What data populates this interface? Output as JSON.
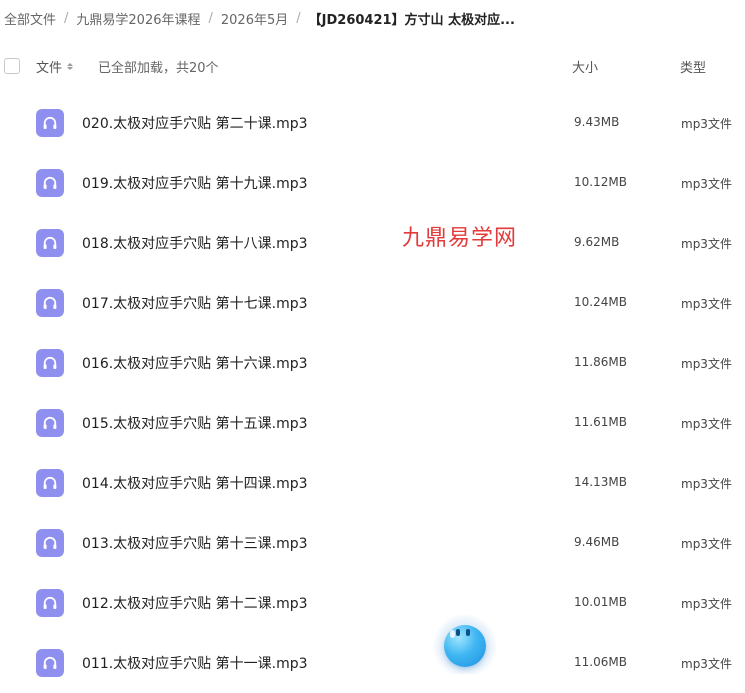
{
  "breadcrumb": [
    {
      "label": "全部文件",
      "current": false
    },
    {
      "label": "九鼎易学2026年课程",
      "current": false
    },
    {
      "label": "2026年5月",
      "current": false
    },
    {
      "label": "【JD260421】方寸山 太极对应...",
      "current": true
    }
  ],
  "breadcrumb_separator": "/",
  "header": {
    "name_label": "文件",
    "loaded_text": "已全部加载，共20个",
    "size_label": "大小",
    "type_label": "类型"
  },
  "files": [
    {
      "name": "020.太极对应手穴贴 第二十课.mp3",
      "size": "9.43MB",
      "type": "mp3文件",
      "icon": "headphones-icon"
    },
    {
      "name": "019.太极对应手穴贴 第十九课.mp3",
      "size": "10.12MB",
      "type": "mp3文件",
      "icon": "headphones-icon"
    },
    {
      "name": "018.太极对应手穴贴 第十八课.mp3",
      "size": "9.62MB",
      "type": "mp3文件",
      "icon": "headphones-icon"
    },
    {
      "name": "017.太极对应手穴贴 第十七课.mp3",
      "size": "10.24MB",
      "type": "mp3文件",
      "icon": "headphones-icon"
    },
    {
      "name": "016.太极对应手穴贴 第十六课.mp3",
      "size": "11.86MB",
      "type": "mp3文件",
      "icon": "headphones-icon"
    },
    {
      "name": "015.太极对应手穴贴 第十五课.mp3",
      "size": "11.61MB",
      "type": "mp3文件",
      "icon": "headphones-icon"
    },
    {
      "name": "014.太极对应手穴贴 第十四课.mp3",
      "size": "14.13MB",
      "type": "mp3文件",
      "icon": "headphones-icon"
    },
    {
      "name": "013.太极对应手穴贴 第十三课.mp3",
      "size": "9.46MB",
      "type": "mp3文件",
      "icon": "headphones-icon"
    },
    {
      "name": "012.太极对应手穴贴 第十二课.mp3",
      "size": "10.01MB",
      "type": "mp3文件",
      "icon": "headphones-icon"
    },
    {
      "name": "011.太极对应手穴贴 第十一课.mp3",
      "size": "11.06MB",
      "type": "mp3文件",
      "icon": "headphones-icon"
    }
  ],
  "watermark": "九鼎易学网",
  "colors": {
    "icon_bg": "#8f8ff0",
    "watermark": "#e33a3a",
    "assistant_bubble": "#3fb6f2"
  }
}
